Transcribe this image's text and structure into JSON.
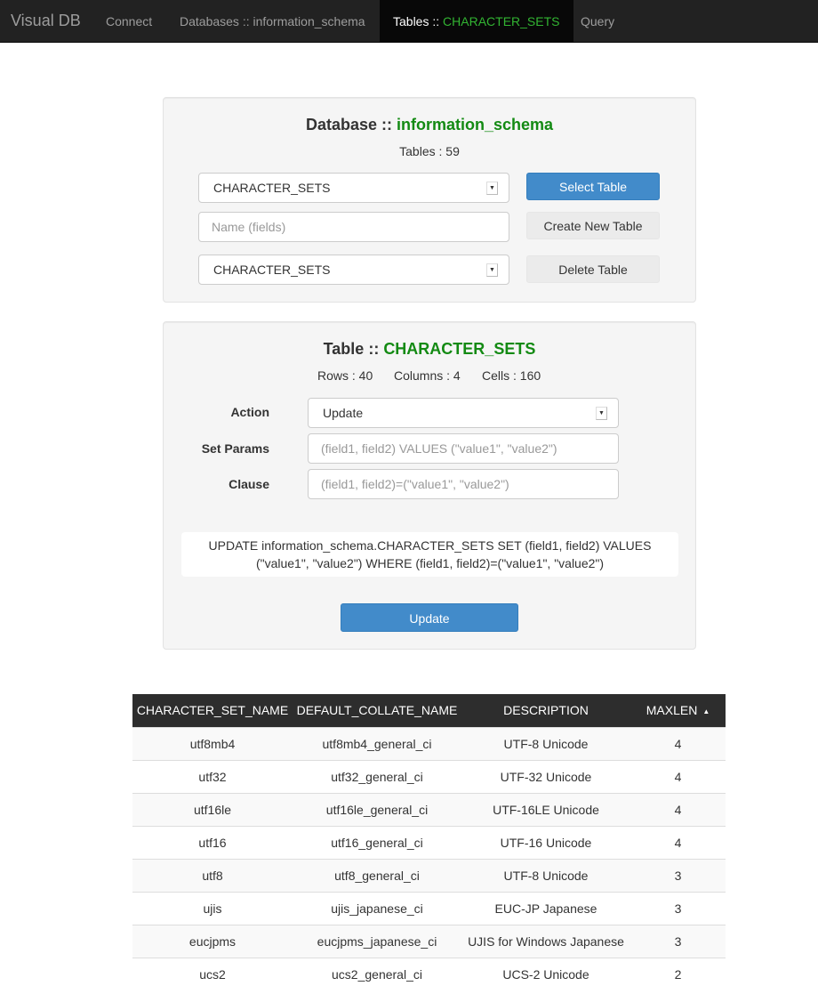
{
  "navbar": {
    "brand": "Visual DB",
    "items": [
      {
        "label": "Connect"
      },
      {
        "label": "Databases :: information_schema"
      },
      {
        "label_prefix": "Tables :: ",
        "label_highlight": "CHARACTER_SETS"
      },
      {
        "label": "Query"
      }
    ]
  },
  "database_panel": {
    "title_prefix": "Database :: ",
    "title_name": "information_schema",
    "tables_count": "Tables : 59",
    "select_table_value": "CHARACTER_SETS",
    "select_table_button": "Select Table",
    "name_placeholder": "Name (fields)",
    "create_button": "Create New Table",
    "delete_table_value": "CHARACTER_SETS",
    "delete_button": "Delete Table"
  },
  "table_panel": {
    "title_prefix": "Table :: ",
    "title_name": "CHARACTER_SETS",
    "rows": "Rows : 40",
    "columns": "Columns : 4",
    "cells": "Cells : 160",
    "action_label": "Action",
    "action_value": "Update",
    "set_params_label": "Set Params",
    "set_params_placeholder": "(field1, field2) VALUES (\"value1\", \"value2\")",
    "clause_label": "Clause",
    "clause_placeholder": "(field1, field2)=(\"value1\", \"value2\")",
    "query_line1": "UPDATE information_schema.CHARACTER_SETS SET (field1, field2) VALUES",
    "query_line2": "(\"value1\", \"value2\") WHERE (field1, field2)=(\"value1\", \"value2\")",
    "update_button": "Update"
  },
  "data_table": {
    "headers": [
      "CHARACTER_SET_NAME",
      "DEFAULT_COLLATE_NAME",
      "DESCRIPTION",
      "MAXLEN"
    ],
    "sort_indicator": "▲",
    "rows": [
      [
        "utf8mb4",
        "utf8mb4_general_ci",
        "UTF-8 Unicode",
        "4"
      ],
      [
        "utf32",
        "utf32_general_ci",
        "UTF-32 Unicode",
        "4"
      ],
      [
        "utf16le",
        "utf16le_general_ci",
        "UTF-16LE Unicode",
        "4"
      ],
      [
        "utf16",
        "utf16_general_ci",
        "UTF-16 Unicode",
        "4"
      ],
      [
        "utf8",
        "utf8_general_ci",
        "UTF-8 Unicode",
        "3"
      ],
      [
        "ujis",
        "ujis_japanese_ci",
        "EUC-JP Japanese",
        "3"
      ],
      [
        "eucjpms",
        "eucjpms_japanese_ci",
        "UJIS for Windows Japanese",
        "3"
      ],
      [
        "ucs2",
        "ucs2_general_ci",
        "UCS-2 Unicode",
        "2"
      ]
    ]
  },
  "colors": {
    "navbar_bg": "#222222",
    "highlight_green": "#138a13",
    "primary_button": "#428bca",
    "table_header_bg": "#2d2d2d"
  }
}
